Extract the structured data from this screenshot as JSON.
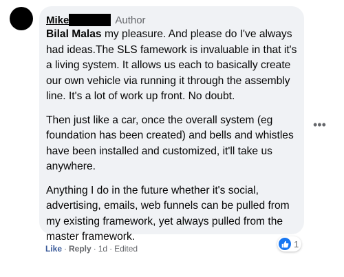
{
  "comment": {
    "author": "Mike",
    "badge": "Author",
    "mention": "Bilal Malas",
    "paragraphs": [
      " my pleasure. And please do I've always had ideas.The SLS famework is invaluable in that it's a living system. It allows us each to basically create our own vehicle via running it through the assembly line. It's a lot of work up front. No doubt.",
      "Then just like a car, once the overall system (eg foundation has been created) and bells and whistles have been installed and customized, it'll take us anywhere.",
      "Anything I do in the future whether it's social, advertising, emails, web funnels can be pulled from my existing framework, yet always pulled from the master framework."
    ],
    "reaction_count": "1"
  },
  "actions": {
    "like": "Like",
    "reply": "Reply",
    "time": "1d",
    "edited": "Edited",
    "separator": "·"
  },
  "icons": {
    "avatar": "avatar",
    "more": "more-options-icon",
    "reaction": "like-reaction-icon"
  },
  "colors": {
    "bubble": "#f0f2f5",
    "like_blue": "#1877f2",
    "link_blue": "#385898",
    "meta_gray": "#65676b"
  }
}
